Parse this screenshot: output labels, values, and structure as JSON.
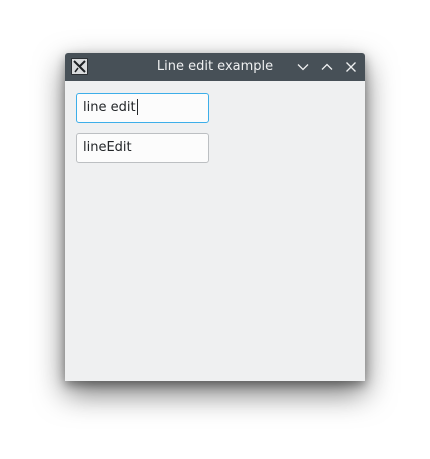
{
  "window": {
    "title": "Line edit example",
    "app_icon": "x-window-icon",
    "controls": {
      "minimize": "chevron-down-icon",
      "maximize": "chevron-up-icon",
      "close": "close-icon"
    }
  },
  "fields": [
    {
      "value": "line edit",
      "focused": true
    },
    {
      "value": "lineEdit",
      "focused": false
    }
  ],
  "colors": {
    "titlebar": "#475057",
    "window_bg": "#eff0f1",
    "focus_border": "#3daee9",
    "field_border": "#bcbfc2"
  }
}
